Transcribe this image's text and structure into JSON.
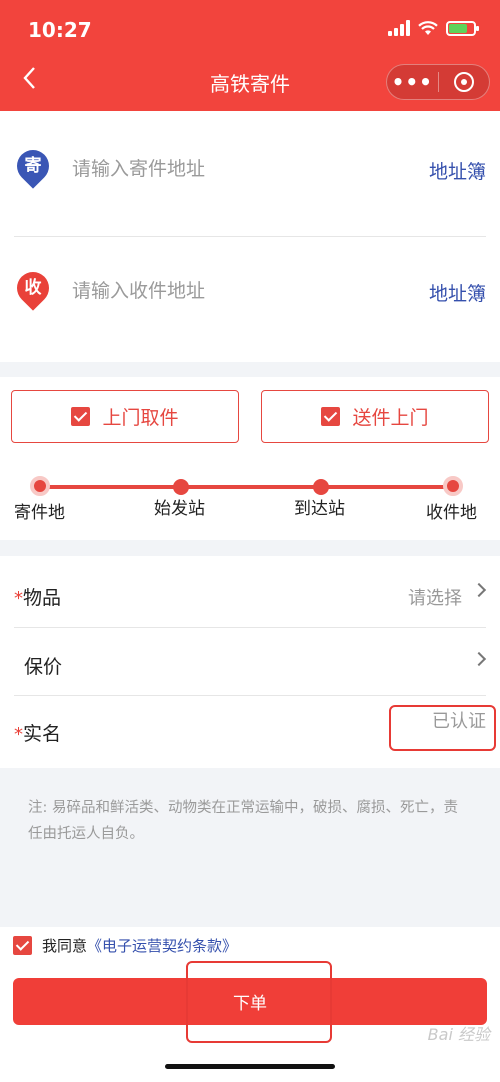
{
  "status_bar": {
    "time": "10:27"
  },
  "nav": {
    "title": "高铁寄件",
    "more": "•••"
  },
  "address": {
    "send": {
      "badge": "寄",
      "placeholder": "请输入寄件地址",
      "book": "地址簿"
    },
    "recv": {
      "badge": "收",
      "placeholder": "请输入收件地址",
      "book": "地址簿"
    }
  },
  "service": {
    "pickup": "上门取件",
    "deliver": "送件上门",
    "stops": [
      "寄件地",
      "始发站",
      "到达站",
      "收件地"
    ]
  },
  "form": {
    "items": {
      "required": "*",
      "label": "物品",
      "value": "请选择"
    },
    "insure": {
      "label": "保价"
    },
    "realname": {
      "required": "*",
      "label": "实名",
      "value": "已认证"
    }
  },
  "note": "注: 易碎品和鲜活类、动物类在正常运输中，破损、腐损、死亡，责任由托运人自负。",
  "agree": {
    "text": "我同意",
    "link": "《电子运营契约条款》"
  },
  "submit": "下单",
  "watermark": "Bai 经验",
  "colors": {
    "primary": "#f2443d",
    "link": "#3550ad",
    "send_badge": "#3a56b5",
    "recv_badge": "#e94139"
  }
}
